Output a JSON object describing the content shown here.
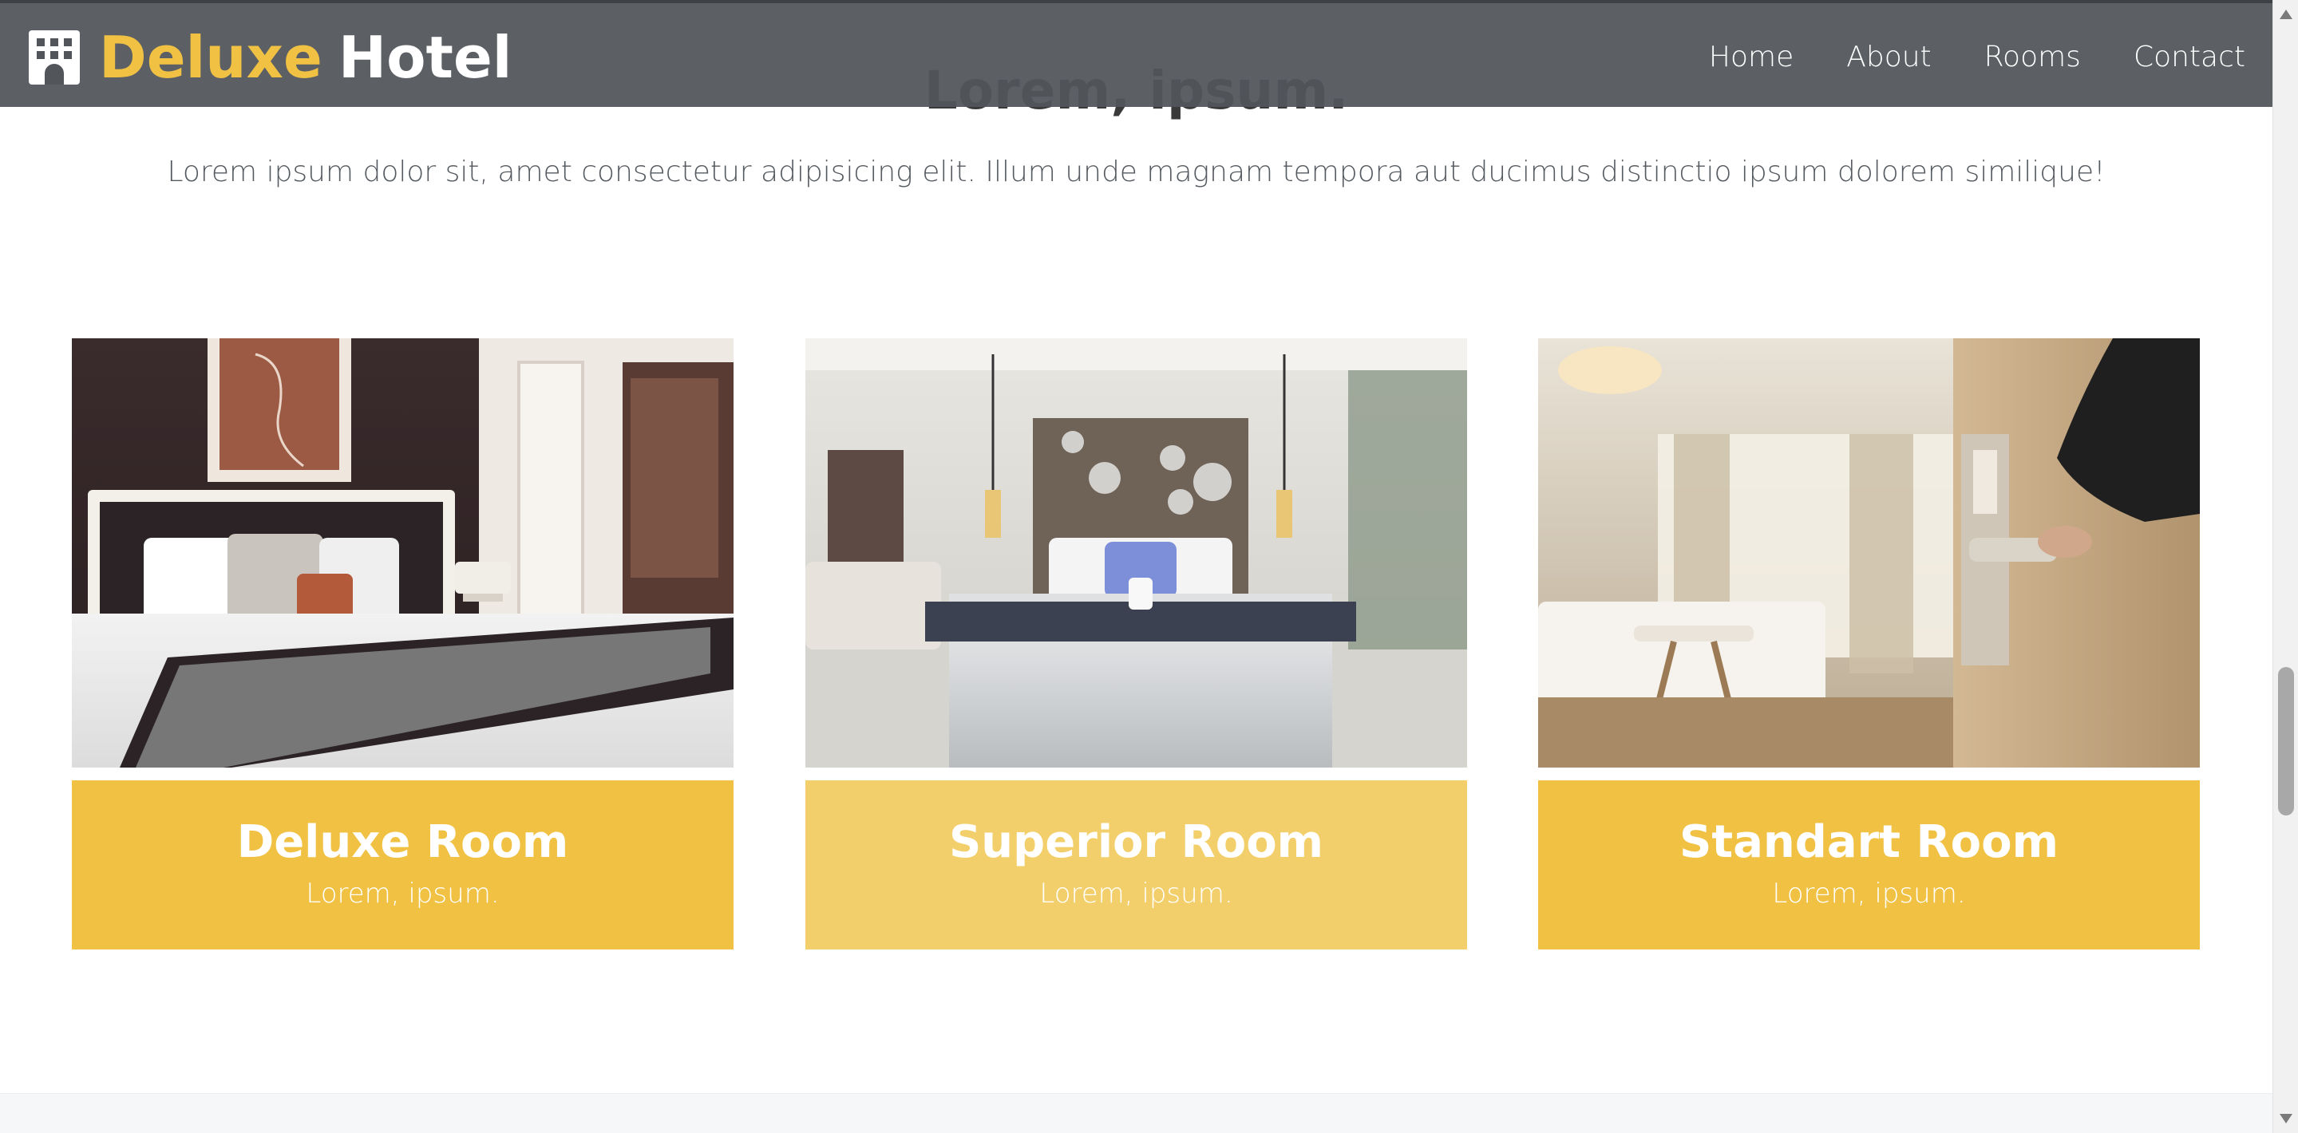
{
  "navbar": {
    "brand_part1": "Deluxe",
    "brand_part2": "Hotel",
    "brand_icon": "hotel-building-icon",
    "links": [
      "Home",
      "About",
      "Rooms",
      "Contact"
    ]
  },
  "section": {
    "title": "Lorem, ipsum.",
    "text": "Lorem ipsum dolor sit, amet consectetur adipisicing elit. Illum unde magnam tempora aut ducimus distinctio ipsum dolorem similique!"
  },
  "rooms": [
    {
      "name": "Deluxe Room",
      "subtitle": "Lorem, ipsum."
    },
    {
      "name": "Superior Room",
      "subtitle": "Lorem, ipsum."
    },
    {
      "name": "Standart Room",
      "subtitle": "Lorem, ipsum."
    }
  ],
  "colors": {
    "accent": "#f0c143",
    "accent_light": "#f3cf6b",
    "navbar": "#52565b",
    "text": "#555a60"
  }
}
